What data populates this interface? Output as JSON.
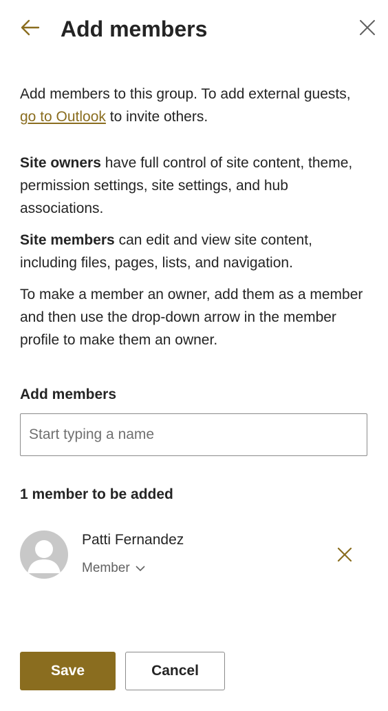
{
  "colors": {
    "accent": "#8a6d1f",
    "text": "#242424",
    "muted": "#616161",
    "avatar_bg": "#c8c8c8"
  },
  "header": {
    "title": "Add members",
    "back_icon": "arrow-left-icon",
    "close_icon": "close-icon"
  },
  "intro": {
    "text_before": "Add members to this group. To add external guests, ",
    "link": "go to Outlook",
    "text_after": " to invite others."
  },
  "owners": {
    "bold": "Site owners",
    "text": " have full control of site content, theme, permission settings, site settings, and hub associations."
  },
  "members_desc": {
    "bold": "Site members",
    "text": " can edit and view site content, including files, pages, lists, and navigation."
  },
  "owner_howto": "To make a member an owner, add them as a member and then use the drop-down arrow in the member profile to make them an owner.",
  "add_members": {
    "label": "Add members",
    "placeholder": "Start typing a name",
    "value": ""
  },
  "pending": {
    "count_label": "1 member to be added",
    "members": [
      {
        "name": "Patti Fernandez",
        "role": "Member",
        "avatar_icon": "person-icon",
        "remove_icon": "close-icon"
      }
    ]
  },
  "footer": {
    "save": "Save",
    "cancel": "Cancel"
  }
}
